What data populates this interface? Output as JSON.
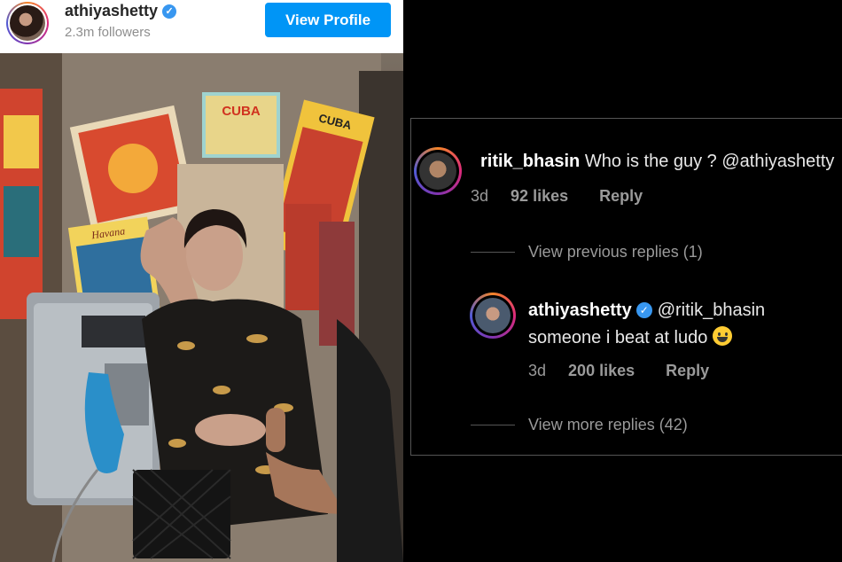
{
  "post": {
    "username": "athiyashetty",
    "followers": "2.3m followers",
    "view_profile_label": "View Profile"
  },
  "photo": {
    "sign_cuba_1": "CUBA",
    "sign_cuba_2": "CUBA",
    "sign_havana": "Havana"
  },
  "comments": {
    "first": {
      "username": "ritik_bhasin",
      "text": "Who is the guy ? @athiyashetty",
      "age": "3d",
      "likes": "92 likes",
      "reply": "Reply"
    },
    "view_previous": "View previous replies (1)",
    "second": {
      "username": "athiyashetty",
      "mention": "@ritik_bhasin",
      "text": "someone i beat at ludo",
      "age": "3d",
      "likes": "200 likes",
      "reply": "Reply"
    },
    "view_more": "View more replies (42)"
  },
  "colors": {
    "button_blue": "#0095f6",
    "verified_blue": "#3897f0"
  }
}
